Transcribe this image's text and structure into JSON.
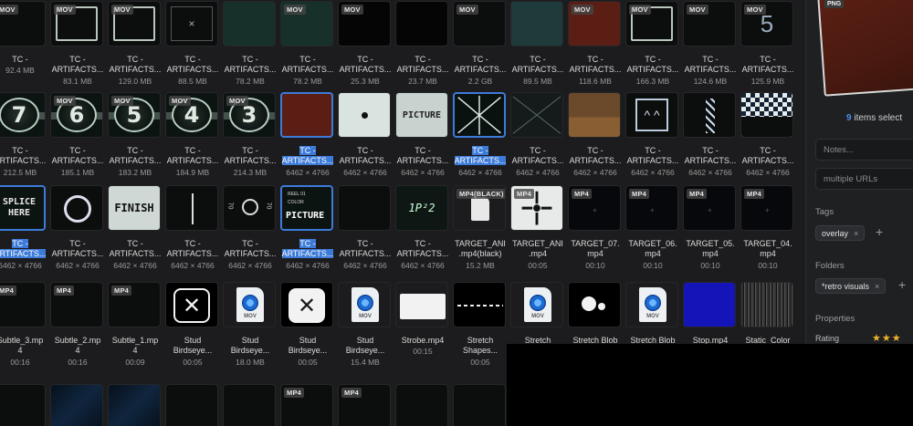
{
  "rows": [
    {
      "cells": [
        {
          "badge": "MOV",
          "name": "TC -",
          "name2": "",
          "meta": "92.4 MB",
          "thumb": "dark"
        },
        {
          "badge": "MOV",
          "name": "TC -",
          "name2": "ARTIFACTS...",
          "meta": "83.1 MB",
          "thumb": "frame"
        },
        {
          "badge": "MOV",
          "name": "TC -",
          "name2": "ARTIFACTS...",
          "meta": "129.0 MB",
          "thumb": "frame"
        },
        {
          "badge": "",
          "name": "TC -",
          "name2": "ARTIFACTS...",
          "meta": "88.5 MB",
          "thumb": "xsmall"
        },
        {
          "badge": "",
          "name": "TC -",
          "name2": "ARTIFACTS...",
          "meta": "78.2 MB",
          "thumb": "green"
        },
        {
          "badge": "MOV",
          "name": "TC -",
          "name2": "ARTIFACTS...",
          "meta": "78.2 MB",
          "thumb": "green"
        },
        {
          "badge": "MOV",
          "name": "TC -",
          "name2": "ARTIFACTS...",
          "meta": "25.3 MB",
          "thumb": "black"
        },
        {
          "badge": "",
          "name": "TC -",
          "name2": "ARTIFACTS...",
          "meta": "23.7 MB",
          "thumb": "black"
        },
        {
          "badge": "MOV",
          "name": "TC -",
          "name2": "ARTIFACTS...",
          "meta": "2.2 GB",
          "thumb": "dark"
        },
        {
          "badge": "",
          "name": "TC -",
          "name2": "ARTIFACTS...",
          "meta": "89.5 MB",
          "thumb": "teal"
        },
        {
          "badge": "MOV",
          "name": "TC -",
          "name2": "ARTIFACTS...",
          "meta": "118.6 MB",
          "thumb": "red"
        },
        {
          "badge": "MOV",
          "name": "TC -",
          "name2": "ARTIFACTS...",
          "meta": "166.3 MB",
          "thumb": "frame"
        },
        {
          "badge": "MOV",
          "name": "TC -",
          "name2": "ARTIFACTS...",
          "meta": "124.6 MB",
          "thumb": "dark"
        },
        {
          "badge": "MOV",
          "name": "TC -",
          "name2": "ARTIFACTS...",
          "meta": "125.9 MB",
          "thumb": "five"
        }
      ]
    },
    {
      "cells": [
        {
          "badge": "",
          "name": "TC -",
          "name2": "ARTIFACTS...",
          "meta": "212.5 MB",
          "thumb": "num",
          "num": "7",
          "sel": false
        },
        {
          "badge": "MOV",
          "name": "TC -",
          "name2": "ARTIFACTS...",
          "meta": "185.1 MB",
          "thumb": "num",
          "num": "6"
        },
        {
          "badge": "MOV",
          "name": "TC -",
          "name2": "ARTIFACTS...",
          "meta": "183.2 MB",
          "thumb": "num",
          "num": "5"
        },
        {
          "badge": "MOV",
          "name": "TC -",
          "name2": "ARTIFACTS...",
          "meta": "184.9 MB",
          "thumb": "num",
          "num": "4"
        },
        {
          "badge": "MOV",
          "name": "TC -",
          "name2": "ARTIFACTS...",
          "meta": "214.3 MB",
          "thumb": "num",
          "num": "3"
        },
        {
          "badge": "",
          "name": "TC -",
          "name2": "ARTIFACTS...",
          "meta": "6462 × 4766",
          "thumb": "red",
          "sel": true
        },
        {
          "badge": "",
          "name": "TC -",
          "name2": "ARTIFACTS...",
          "meta": "6462 × 4766",
          "thumb": "dot"
        },
        {
          "badge": "",
          "name": "TC -",
          "name2": "ARTIFACTS...",
          "meta": "6462 × 4766",
          "thumb": "picture"
        },
        {
          "badge": "",
          "name": "TC -",
          "name2": "ARTIFACTS...",
          "meta": "6462 × 4766",
          "thumb": "star",
          "sel": true
        },
        {
          "badge": "",
          "name": "TC -",
          "name2": "ARTIFACTS...",
          "meta": "6462 × 4766",
          "thumb": "xlines"
        },
        {
          "badge": "",
          "name": "TC -",
          "name2": "ARTIFACTS...",
          "meta": "6462 × 4766",
          "thumb": "brown"
        },
        {
          "badge": "",
          "name": "TC -",
          "name2": "ARTIFACTS...",
          "meta": "6462 × 4766",
          "thumb": "chevrons"
        },
        {
          "badge": "",
          "name": "TC -",
          "name2": "ARTIFACTS...",
          "meta": "6462 × 4766",
          "thumb": "helix"
        },
        {
          "badge": "",
          "name": "TC -",
          "name2": "ARTIFACTS...",
          "meta": "6462 × 4766",
          "thumb": "checker"
        }
      ]
    },
    {
      "cells": [
        {
          "badge": "",
          "name": "TC -",
          "name2": "ARTIFACTS...",
          "meta": "6462 × 4766",
          "thumb": "splice",
          "sel": true
        },
        {
          "badge": "",
          "name": "TC -",
          "name2": "ARTIFACTS...",
          "meta": "6462 × 4766",
          "thumb": "ring"
        },
        {
          "badge": "",
          "name": "TC -",
          "name2": "ARTIFACTS...",
          "meta": "6462 × 4766",
          "thumb": "finish"
        },
        {
          "badge": "",
          "name": "TC -",
          "name2": "ARTIFACTS...",
          "meta": "6462 × 4766",
          "thumb": "arrow"
        },
        {
          "badge": "",
          "name": "TC -",
          "name2": "ARTIFACTS...",
          "meta": "6462 × 4766",
          "thumb": "sound"
        },
        {
          "badge": "",
          "name": "TC -",
          "name2": "ARTIFACTS...",
          "meta": "6462 × 4766",
          "thumb": "picture2",
          "sel": true
        },
        {
          "badge": "",
          "name": "TC -",
          "name2": "ARTIFACTS...",
          "meta": "6462 × 4766",
          "thumb": "dark"
        },
        {
          "badge": "",
          "name": "TC -",
          "name2": "ARTIFACTS...",
          "meta": "6462 × 4766",
          "thumb": "scribble"
        },
        {
          "badge": "MP4(BLACK)",
          "name": "TARGET_ANI",
          "name2": ".mp4(black)",
          "meta": "15.2 MB",
          "thumb": "docplain"
        },
        {
          "badge": "MP4",
          "name": "TARGET_ANI",
          "name2": ".mp4",
          "meta": "00:05",
          "thumb": "target"
        },
        {
          "badge": "MP4",
          "name": "TARGET_07.",
          "name2": "mp4",
          "meta": "00:10",
          "thumb": "tiny"
        },
        {
          "badge": "MP4",
          "name": "TARGET_06.",
          "name2": "mp4",
          "meta": "00:10",
          "thumb": "tiny"
        },
        {
          "badge": "MP4",
          "name": "TARGET_05.",
          "name2": "mp4",
          "meta": "00:10",
          "thumb": "tiny"
        },
        {
          "badge": "MP4",
          "name": "TARGET_04.",
          "name2": "mp4",
          "meta": "00:10",
          "thumb": "tiny"
        }
      ]
    },
    {
      "cells": [
        {
          "badge": "MP4",
          "name": "Subtle_3.mp",
          "name2": "4",
          "meta": "00:16",
          "thumb": "dark"
        },
        {
          "badge": "MP4",
          "name": "Subtle_2.mp",
          "name2": "4",
          "meta": "00:16",
          "thumb": "dark"
        },
        {
          "badge": "MP4",
          "name": "Subtle_1.mp",
          "name2": "4",
          "meta": "00:09",
          "thumb": "dark"
        },
        {
          "badge": "",
          "name": "Stud",
          "name2": "Birdseye...",
          "meta": "00:05",
          "thumb": "xbox"
        },
        {
          "badge": "",
          "name": "Stud",
          "name2": "Birdseye...",
          "meta": "18.0 MB",
          "thumb": "movdoc"
        },
        {
          "badge": "",
          "name": "Stud",
          "name2": "Birdseye...",
          "meta": "00:05",
          "thumb": "xboxlight"
        },
        {
          "badge": "",
          "name": "Stud",
          "name2": "Birdseye...",
          "meta": "15.4 MB",
          "thumb": "movdoc"
        },
        {
          "badge": "",
          "name": "Strobe.mp4",
          "name2": "",
          "meta": "00:15",
          "thumb": "white"
        },
        {
          "badge": "",
          "name": "Stretch",
          "name2": "Shapes...",
          "meta": "00:05",
          "thumb": "dashes"
        },
        {
          "badge": "",
          "name": "Stretch",
          "name2": "",
          "meta": "",
          "thumb": "movdoc"
        },
        {
          "badge": "",
          "name": "Stretch Blob",
          "name2": "",
          "meta": "",
          "thumb": "blob"
        },
        {
          "badge": "",
          "name": "Stretch Blob",
          "name2": "",
          "meta": "",
          "thumb": "movdoc"
        },
        {
          "badge": "",
          "name": "Stop.mp4",
          "name2": "",
          "meta": "",
          "thumb": "blue"
        },
        {
          "badge": "",
          "name": "Static_Color",
          "name2": "",
          "meta": "",
          "thumb": "static"
        }
      ]
    },
    {
      "cells": [
        {
          "badge": "",
          "name": "",
          "name2": "",
          "meta": "",
          "thumb": "dark"
        },
        {
          "badge": "",
          "name": "",
          "name2": "",
          "meta": "",
          "thumb": "night"
        },
        {
          "badge": "",
          "name": "",
          "name2": "",
          "meta": "",
          "thumb": "night"
        },
        {
          "badge": "",
          "name": "",
          "name2": "",
          "meta": "",
          "thumb": "dark"
        },
        {
          "badge": "",
          "name": "",
          "name2": "",
          "meta": "",
          "thumb": "dark"
        },
        {
          "badge": "MP4",
          "name": "",
          "name2": "",
          "meta": "",
          "thumb": "dark"
        },
        {
          "badge": "MP4",
          "name": "",
          "name2": "",
          "meta": "",
          "thumb": "dark"
        },
        {
          "badge": "",
          "name": "",
          "name2": "",
          "meta": "",
          "thumb": "dark"
        },
        {
          "badge": "",
          "name": "",
          "name2": "",
          "meta": "",
          "thumb": "dark"
        }
      ]
    }
  ],
  "thumb_text": {
    "picture": "PICTURE",
    "finish": "FINISH",
    "splice": "SPLICE HERE",
    "picture2": "PICTURE",
    "reel": "REEL 01",
    "color": "COLOR",
    "sound_a": "70",
    "sound_b": "70",
    "sound_label": "SOUND START",
    "scribble": "1P²2",
    "mov_label": "MOV"
  },
  "sidebar": {
    "preview_badge": "PNG",
    "count": "9",
    "count_suffix": " items select",
    "notes_placeholder": "Notes...",
    "url_placeholder": "multiple URLs",
    "tags_title": "Tags",
    "tag": "overlay",
    "folders_title": "Folders",
    "folder": "*retro visuals",
    "properties_title": "Properties",
    "rating_label": "Rating",
    "rating_stars": "★★★",
    "close_glyph": "×",
    "plus_glyph": "+"
  },
  "colors": {
    "accent": "#3d7bd9",
    "background": "#1c1c1e",
    "star": "#f0b22d"
  }
}
